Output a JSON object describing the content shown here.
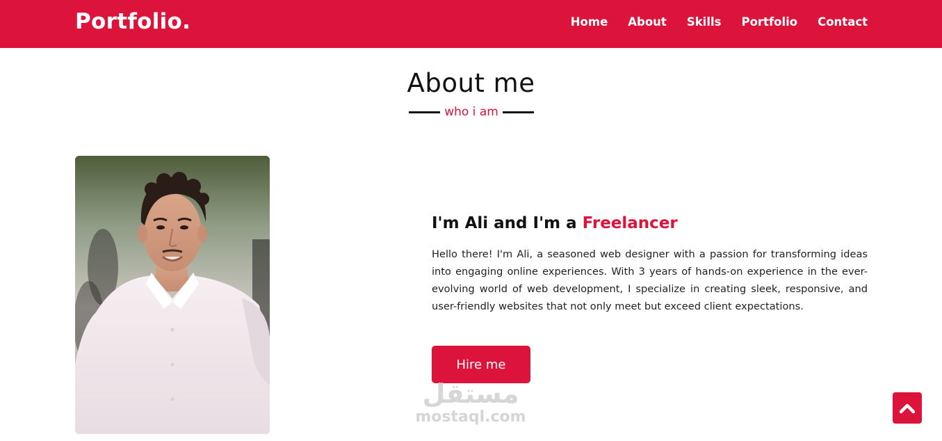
{
  "nav": {
    "logo": "Portfolio.",
    "items": [
      {
        "label": "Home"
      },
      {
        "label": "About"
      },
      {
        "label": "Skills"
      },
      {
        "label": "Portfolio"
      },
      {
        "label": "Contact"
      }
    ]
  },
  "section": {
    "title": "About me",
    "subtitle": "who i am"
  },
  "about": {
    "heading_prefix": "I'm Ali and I'm a ",
    "heading_role": "Freelancer",
    "text": "Hello there! I'm Ali, a seasoned web designer with a passion for transforming ideas into engaging online experiences. With 3 years of hands-on experience in the ever-evolving world of web development, I specialize in creating sleek, responsive, and user-friendly websites that not only meet but exceed client expectations.",
    "button_label": "Hire me"
  },
  "watermark": {
    "arabic": "مستقل",
    "latin": "mostaql.com"
  },
  "icons": {
    "scroll_top": "chevron-up-icon",
    "photo": "profile-photo"
  },
  "colors": {
    "accent": "#dc143c",
    "text": "#111111",
    "background": "#ffffff"
  }
}
